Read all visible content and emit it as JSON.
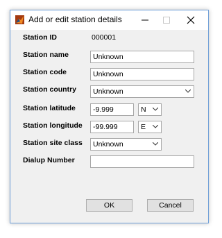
{
  "window": {
    "title": "Add or edit station details"
  },
  "station_id": {
    "label": "Station ID",
    "value": "000001"
  },
  "station_name": {
    "label": "Station name",
    "value": "Unknown"
  },
  "station_code": {
    "label": "Station code",
    "value": "Unknown"
  },
  "station_country": {
    "label": "Station country",
    "value": "Unknown"
  },
  "station_latitude": {
    "label": "Station latitude",
    "value": "-9.999",
    "hemisphere": "N"
  },
  "station_longitude": {
    "label": "Station longitude",
    "value": "-99.999",
    "hemisphere": "E"
  },
  "station_site_class": {
    "label": "Station site class",
    "value": "Unknown"
  },
  "dialup_number": {
    "label": "Dialup Number",
    "value": ""
  },
  "buttons": {
    "ok": "OK",
    "cancel": "Cancel"
  },
  "icons": {
    "app": "matlab-app-icon",
    "minimize": "minimize-icon",
    "maximize": "maximize-icon",
    "close": "close-icon",
    "dropdown": "chevron-down-icon"
  },
  "colors": {
    "window_border": "#6f9fd8",
    "dialog_bg": "#f0f0f0"
  }
}
